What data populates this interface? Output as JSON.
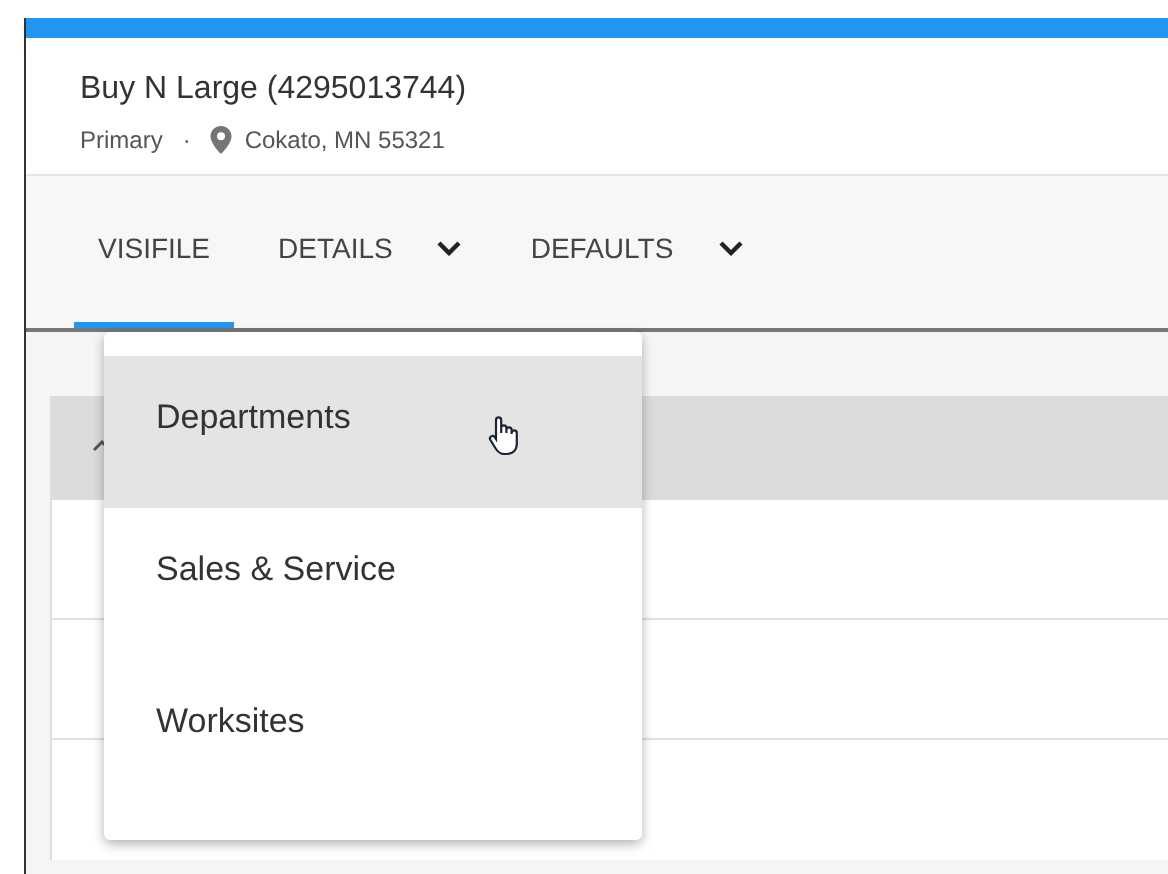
{
  "header": {
    "title": "Buy N Large (4295013744)",
    "type": "Primary",
    "separator": "·",
    "location": "Cokato, MN 55321"
  },
  "tabs": [
    {
      "label": "VISIFILE",
      "selected": true,
      "kind": "plain"
    },
    {
      "label": "DETAILS",
      "selected": false,
      "kind": "dropdown"
    },
    {
      "label": "DEFAULTS",
      "selected": false,
      "kind": "dropdown"
    }
  ],
  "menu": {
    "items": [
      {
        "label": "Departments",
        "selected": true
      },
      {
        "label": "Sales & Service",
        "selected": false
      },
      {
        "label": "Worksites",
        "selected": false
      }
    ]
  }
}
